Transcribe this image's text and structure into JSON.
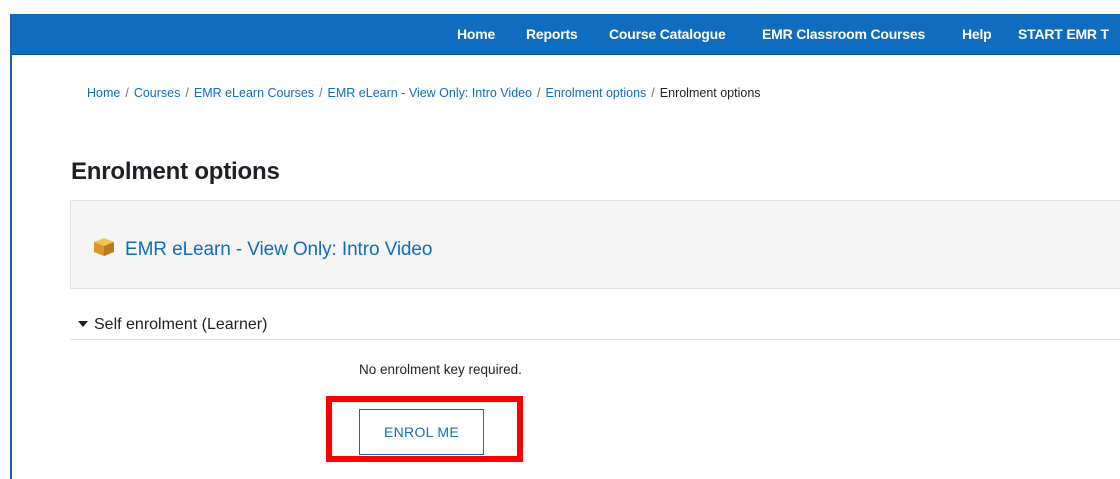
{
  "navbar": {
    "items": [
      {
        "label": "Home"
      },
      {
        "label": "Reports"
      },
      {
        "label": "Course Catalogue"
      },
      {
        "label": "EMR Classroom Courses"
      },
      {
        "label": "Help"
      },
      {
        "label": "START EMR T"
      }
    ],
    "color": "#0f6cbf"
  },
  "breadcrumb": {
    "items": [
      {
        "label": "Home"
      },
      {
        "label": "Courses"
      },
      {
        "label": "EMR eLearn Courses"
      },
      {
        "label": "EMR eLearn - View Only: Intro Video"
      },
      {
        "label": "Enrolment options"
      },
      {
        "label": "Enrolment options"
      }
    ],
    "separator": "/"
  },
  "page": {
    "title": "Enrolment options"
  },
  "course": {
    "name": "EMR eLearn - View Only: Intro Video",
    "icon": "course-box-icon"
  },
  "enrolment": {
    "section_title": "Self enrolment (Learner)",
    "key_text": "No enrolment key required.",
    "button_label": "ENROL ME",
    "highlight_color": "#ff0000"
  }
}
